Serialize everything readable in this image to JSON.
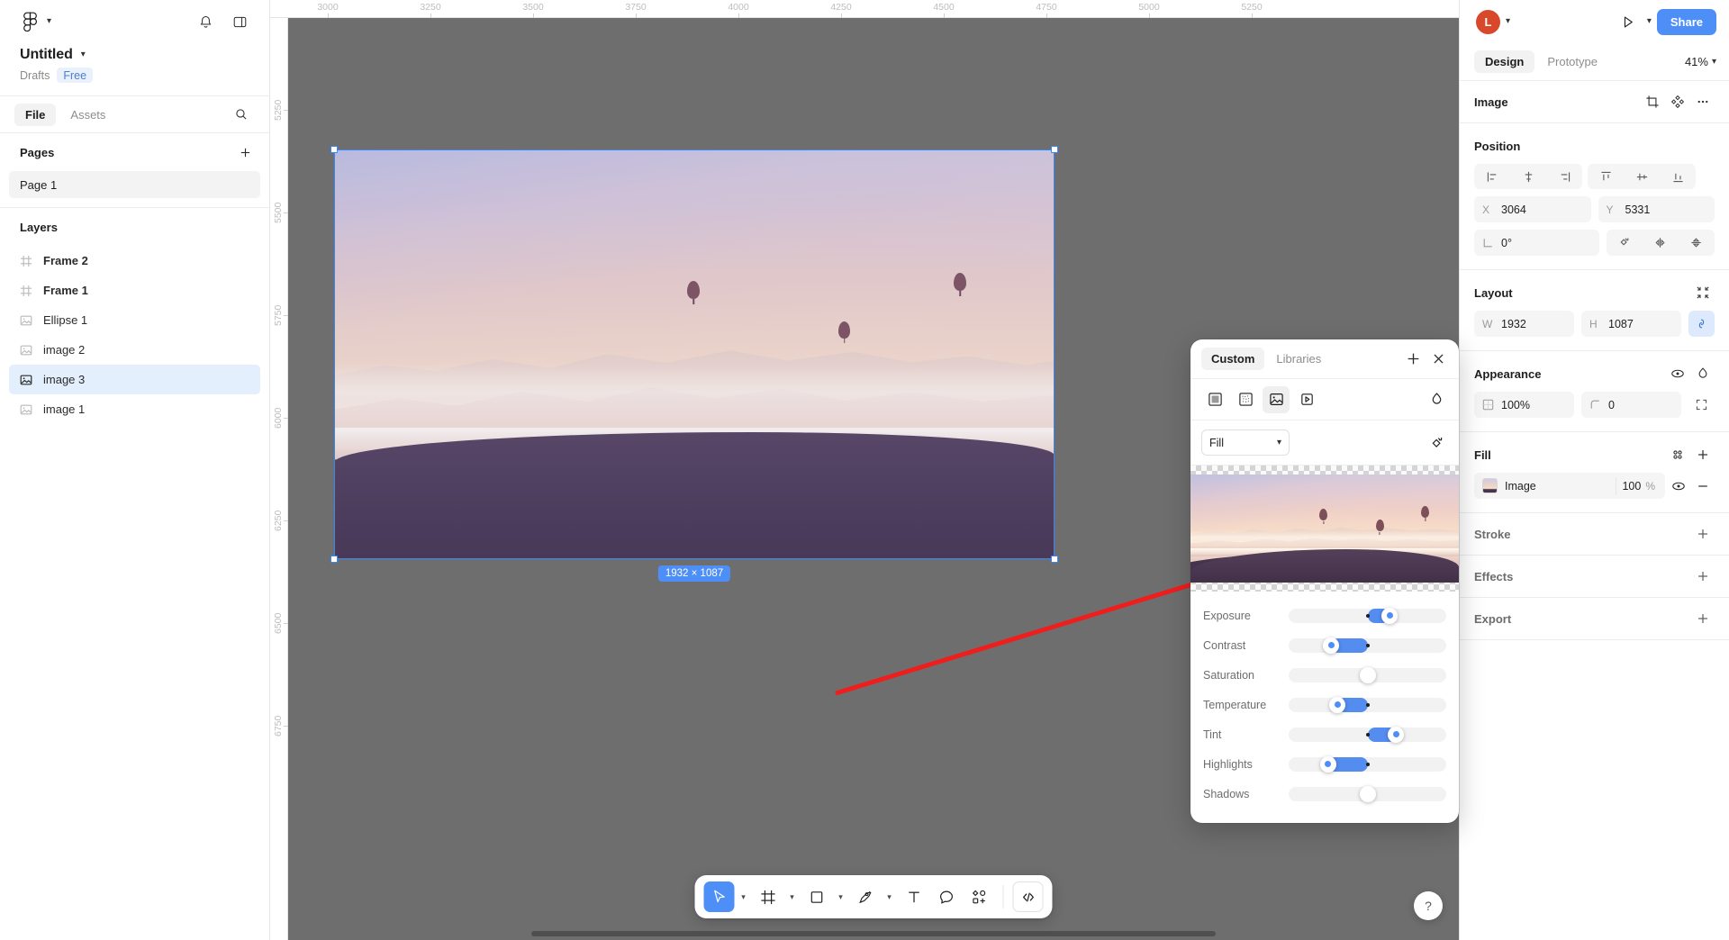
{
  "app": {
    "logo_icon": "figma-logo-icon",
    "notifications_icon": "bell-icon",
    "panel_toggle_icon": "layout-panel-icon"
  },
  "file": {
    "title": "Untitled",
    "title_caret": "chevron-down-icon",
    "location": "Drafts",
    "plan_badge": "Free"
  },
  "left_tabs": [
    {
      "label": "File",
      "active": true
    },
    {
      "label": "Assets",
      "active": false
    }
  ],
  "left_search_icon": "search-icon",
  "pages": {
    "header": "Pages",
    "add_icon": "plus-icon",
    "items": [
      {
        "label": "Page 1",
        "active": true
      }
    ]
  },
  "layers": {
    "header": "Layers",
    "items": [
      {
        "label": "Frame 2",
        "icon": "frame-icon",
        "bold": true,
        "selected": false
      },
      {
        "label": "Frame 1",
        "icon": "frame-icon",
        "bold": true,
        "selected": false
      },
      {
        "label": "Ellipse 1",
        "icon": "image-icon",
        "bold": false,
        "selected": false
      },
      {
        "label": "image 2",
        "icon": "image-icon",
        "bold": false,
        "selected": false
      },
      {
        "label": "image 3",
        "icon": "image-icon",
        "bold": false,
        "selected": true
      },
      {
        "label": "image 1",
        "icon": "image-icon",
        "bold": false,
        "selected": false
      }
    ]
  },
  "canvas": {
    "ruler_h_labels": [
      "3000",
      "3250",
      "3500",
      "3750",
      "4000",
      "4250",
      "4500",
      "4750",
      "5000",
      "5250"
    ],
    "ruler_v_labels": [
      "5250",
      "5500",
      "5750",
      "6000",
      "6250",
      "6500",
      "6750"
    ],
    "selection_badge": "1932 × 1087",
    "background_color": "#6e6e6e",
    "selection_color": "#3a86f7",
    "annotation": "red-arrow-pointing-to-adjust-panel"
  },
  "toolbar": {
    "tools": [
      {
        "name": "move-tool",
        "icon": "cursor-arrow-icon",
        "active": true,
        "caret": true
      },
      {
        "name": "frame-tool",
        "icon": "frame-icon",
        "active": false,
        "caret": true
      },
      {
        "name": "shape-tool",
        "icon": "square-icon",
        "active": false,
        "caret": true
      },
      {
        "name": "pen-tool",
        "icon": "pen-icon",
        "active": false,
        "caret": true
      },
      {
        "name": "text-tool",
        "icon": "text-t-icon",
        "active": false,
        "caret": false
      },
      {
        "name": "comment-tool",
        "icon": "comment-bubble-icon",
        "active": false,
        "caret": false
      },
      {
        "name": "actions-tool",
        "icon": "plugins-shapes-icon",
        "active": false,
        "caret": false
      }
    ],
    "dev_mode": {
      "name": "dev-mode-toggle",
      "icon": "code-brackets-icon"
    }
  },
  "account": {
    "initial": "L",
    "caret_icon": "chevron-down-icon",
    "present_icon": "play-triangle-icon",
    "present_caret_icon": "chevron-down-icon",
    "share_label": "Share"
  },
  "right_tabs": [
    {
      "label": "Design",
      "active": true
    },
    {
      "label": "Prototype",
      "active": false
    }
  ],
  "zoom": {
    "value": "41%",
    "caret_icon": "chevron-down-icon"
  },
  "inspector": {
    "object_type": "Image",
    "header_actions": [
      {
        "name": "crop-icon"
      },
      {
        "name": "component-diamond-icon"
      },
      {
        "name": "more-dots-icon"
      }
    ],
    "position": {
      "title": "Position",
      "align_horizontal": [
        "align-left-icon",
        "align-center-horizontal-icon",
        "align-right-icon"
      ],
      "align_vertical": [
        "align-top-icon",
        "align-center-vertical-icon",
        "align-bottom-icon"
      ],
      "x_key": "X",
      "x_value": "3064",
      "y_key": "Y",
      "y_value": "5331",
      "rotation_key": "angle-icon",
      "rotation_value": "0°",
      "rotate_icon": "rotate-icon",
      "flip_h_icon": "flip-horizontal-icon",
      "flip_v_icon": "flip-vertical-icon"
    },
    "layout": {
      "title": "Layout",
      "resize_icon": "collapse-arrows-icon",
      "w_key": "W",
      "w_value": "1932",
      "h_key": "H",
      "h_value": "1087",
      "aspect_lock_icon": "link-chain-icon",
      "aspect_lock_on": true
    },
    "appearance": {
      "title": "Appearance",
      "visibility_icon": "eye-icon",
      "blend_icon": "blend-droplet-icon",
      "opacity_key": "opacity-icon",
      "opacity_value": "100%",
      "corner_key": "corner-radius-icon",
      "corner_value": "0",
      "independent_corners_icon": "corners-icon"
    },
    "fill": {
      "title": "Fill",
      "styles_icon": "styles-grid-icon",
      "add_icon": "plus-icon",
      "items": [
        {
          "swatch": "image-thumbnail",
          "label": "Image",
          "opacity": "100",
          "opacity_unit": "%",
          "visibility_icon": "eye-icon",
          "remove_icon": "minus-icon"
        }
      ]
    },
    "stroke": {
      "title": "Stroke",
      "add_icon": "plus-icon"
    },
    "effects": {
      "title": "Effects",
      "add_icon": "plus-icon"
    },
    "export": {
      "title": "Export",
      "add_icon": "plus-icon"
    }
  },
  "image_popover": {
    "tabs": [
      {
        "label": "Custom",
        "active": true
      },
      {
        "label": "Libraries",
        "active": false
      }
    ],
    "add_icon": "plus-icon",
    "close_icon": "close-x-icon",
    "paint_types": [
      {
        "name": "solid-paint-icon",
        "active": false
      },
      {
        "name": "gradient-paint-icon",
        "active": false
      },
      {
        "name": "image-paint-icon",
        "active": true
      },
      {
        "name": "video-paint-icon",
        "active": false
      }
    ],
    "blend_icon": "blend-droplet-icon",
    "scale_mode": {
      "value": "Fill",
      "caret_icon": "chevron-down-icon"
    },
    "rotate_icon": "rotate-image-icon",
    "preview": "balloon-sunrise-landscape",
    "adjustments": [
      {
        "label": "Exposure",
        "value": 24,
        "knob": 64,
        "dot": 50,
        "fill_from": 50,
        "fill_to": 64
      },
      {
        "label": "Contrast",
        "value": -24,
        "knob": 27,
        "dot": 50,
        "fill_from": 27,
        "fill_to": 50
      },
      {
        "label": "Saturation",
        "value": 0,
        "knob": 50,
        "dot": null,
        "fill_from": 50,
        "fill_to": 50
      },
      {
        "label": "Temperature",
        "value": -20,
        "knob": 31,
        "dot": 50,
        "fill_from": 31,
        "fill_to": 50
      },
      {
        "label": "Tint",
        "value": 30,
        "knob": 68,
        "dot": 50,
        "fill_from": 50,
        "fill_to": 68
      },
      {
        "label": "Highlights",
        "value": -26,
        "knob": 25,
        "dot": 50,
        "fill_from": 25,
        "fill_to": 50
      },
      {
        "label": "Shadows",
        "value": 0,
        "knob": 50,
        "dot": null,
        "fill_from": 50,
        "fill_to": 50
      }
    ]
  },
  "help": {
    "icon": "question-mark-icon",
    "label": "?"
  }
}
